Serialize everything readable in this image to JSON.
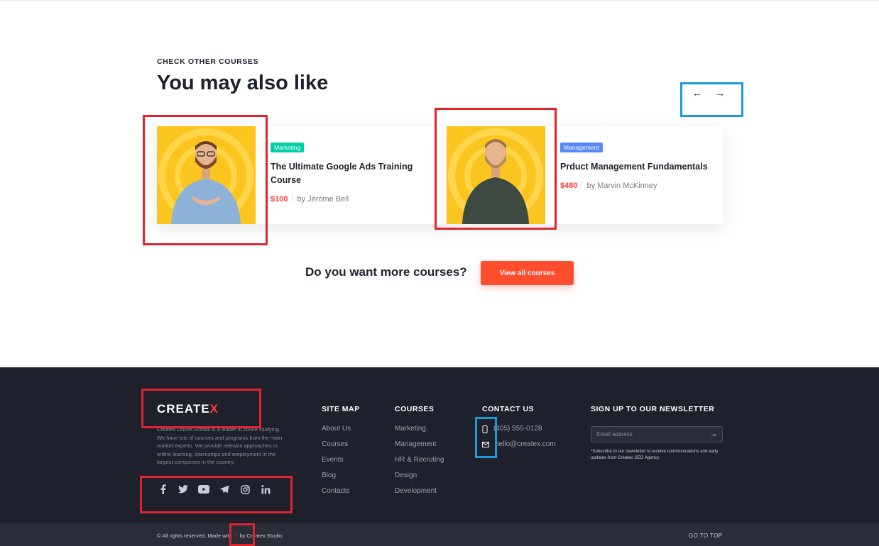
{
  "section": {
    "eyebrow": "CHECK OTHER COURSES",
    "heading": "You may also like",
    "prev_arrow": "←",
    "next_arrow": "→"
  },
  "courses": [
    {
      "category": "Marketing",
      "category_color": "#03cea4",
      "title": "The Ultimate Google Ads Training Course",
      "price": "$100",
      "author": "by Jerome Bell"
    },
    {
      "category": "Management",
      "category_color": "#5a87fc",
      "title": "Prduct Management Fundamentals",
      "price": "$480",
      "author": "by Marvin McKinney"
    }
  ],
  "cta": {
    "text": "Do you want more courses?",
    "button": "View all courses"
  },
  "footer": {
    "logo_main": "CREATE",
    "logo_accent": "X",
    "about": "Createx Online School is a leader in online studying. We have lots of courses and programs from the main market experts. We provide relevant approaches to online learning, internships and employment in the largest companies in the country.",
    "socials": [
      "facebook-icon",
      "twitter-icon",
      "youtube-icon",
      "telegram-icon",
      "instagram-icon",
      "linkedin-icon"
    ],
    "sitemap": {
      "title": "SITE MAP",
      "links": [
        "About Us",
        "Courses",
        "Events",
        "Blog",
        "Contacts"
      ]
    },
    "courses": {
      "title": "COURSES",
      "links": [
        "Marketing",
        "Management",
        "HR & Recruting",
        "Design",
        "Development"
      ]
    },
    "contact": {
      "title": "CONTACT US",
      "phone": "(405) 555-0128",
      "email": "hello@createx.com"
    },
    "newsletter": {
      "title": "SIGN UP TO OUR NEWSLETTER",
      "placeholder": "Email address",
      "note": "*Subscribe to our newsletter to receive communications and early updates from Createx SEO Agency."
    },
    "copyright_before": "© All rights reserved. Made with",
    "copyright_after": "by Createx Studio",
    "go_top": "GO TO TOP"
  },
  "colors": {
    "accent": "#ff3c35",
    "footer_bg": "#1e212c",
    "highlight_red": "#e2232d",
    "highlight_blue": "#1b9bd8"
  }
}
